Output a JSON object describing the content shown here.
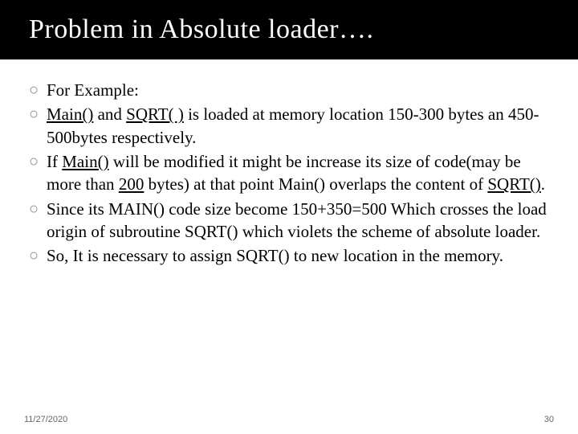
{
  "title": "Problem in Absolute loader….",
  "bullets": [
    {
      "pre": "For Example:"
    },
    {
      "pre": "",
      "u1": "Main()",
      "mid1": " and ",
      "u2": "SQRT( )",
      "post": " is loaded at memory location 150-300 bytes an 450-500bytes respectively."
    },
    {
      "pre": "If ",
      "u1": "Main()",
      "mid1": " will be modified it might be increase its size of code(may be more than ",
      "u2": "200",
      "mid2": " bytes) at that point Main() overlaps the content of ",
      "u3": "SQRT()",
      "post": "."
    },
    {
      "pre": "Since its MAIN() code size become 150+350=500 Which crosses the load origin of subroutine SQRT() which violets the scheme of absolute loader."
    },
    {
      "pre": "So, It is necessary to assign SQRT() to new location in the memory."
    }
  ],
  "footer": {
    "date": "11/27/2020",
    "page": "30"
  }
}
